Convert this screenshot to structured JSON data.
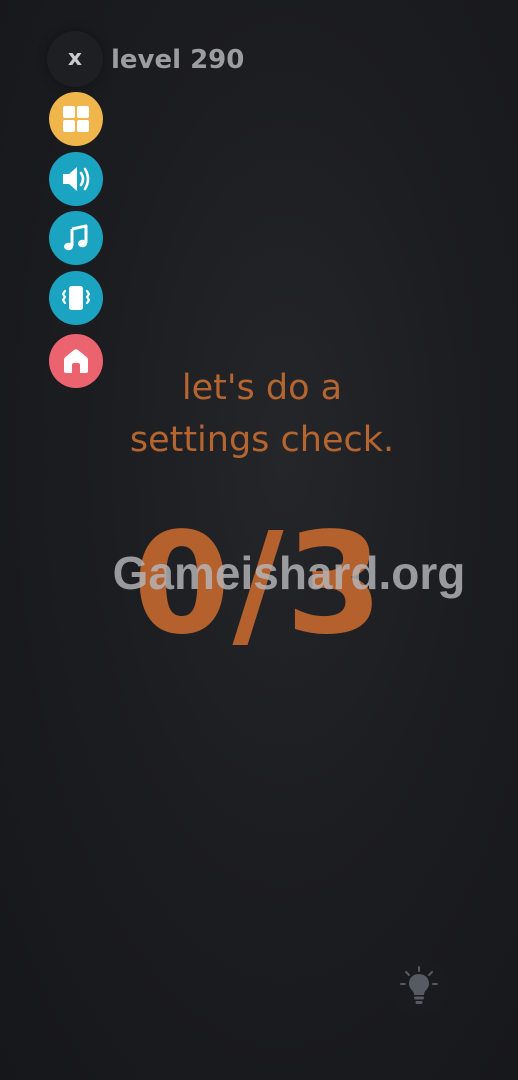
{
  "header": {
    "close_label": "x",
    "level_text": "level 290"
  },
  "side_buttons": [
    {
      "icon": "grid-icon",
      "color": "#f0b54b"
    },
    {
      "icon": "speaker-icon",
      "color": "#1ba3c2"
    },
    {
      "icon": "music-note-icon",
      "color": "#1ba3c2"
    },
    {
      "icon": "vibrate-icon",
      "color": "#1ba3c2"
    },
    {
      "icon": "home-icon",
      "color": "#ec6370"
    }
  ],
  "main": {
    "prompt": "let's do a\nsettings check.",
    "counter": "0/3"
  },
  "watermark": "Gameishard.org",
  "hint": {
    "icon": "lightbulb-icon"
  },
  "colors": {
    "background": "#1c1d21",
    "accent_orange": "#b5652f",
    "levels_yellow": "#f0b54b",
    "settings_blue": "#1ba3c2",
    "home_pink": "#ec6370"
  }
}
